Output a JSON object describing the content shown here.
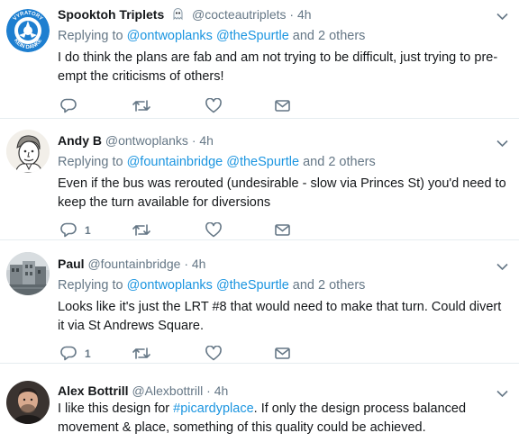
{
  "tweets": [
    {
      "name": "Spooktoh Triplets",
      "handle": "@cocteautriplets",
      "dot": "·",
      "time": "4h",
      "reply_prefix": "Replying to",
      "mention1": "@ontwoplanks",
      "mention2": "@theSpurtle",
      "reply_suffix": "and 2 others",
      "text": "I do think the plans are fab and am not trying to be difficult, just trying to pre-empt the criticisms of others!",
      "reply_count": ""
    },
    {
      "name": "Andy B",
      "handle": "@ontwoplanks",
      "dot": "·",
      "time": "4h",
      "reply_prefix": "Replying to",
      "mention1": "@fountainbridge",
      "mention2": "@theSpurtle",
      "reply_suffix": "and 2 others",
      "text": "Even if the bus was rerouted (undesirable - slow via Princes St) you'd need to keep the turn available for diversions",
      "reply_count": "1"
    },
    {
      "name": "Paul",
      "handle": "@fountainbridge",
      "dot": "·",
      "time": "4h",
      "reply_prefix": "Replying to",
      "mention1": "@ontwoplanks",
      "mention2": "@theSpurtle",
      "reply_suffix": "and 2 others",
      "text": "Looks like it's just the LRT #8 that would need to make that turn.  Could divert it via St Andrews Square.",
      "reply_count": "1"
    },
    {
      "name": "Alex Bottrill",
      "handle": "@Alexbottrill",
      "dot": "·",
      "time": "4h",
      "text_before": "I like this design for",
      "hashtag": "#picardyplace",
      "text_after": ". If only the design process balanced movement & place, something of this quality could be achieved."
    }
  ],
  "logo_text": {
    "top": "VYRATORY",
    "bottom": "KEIN DANKE"
  },
  "colors": {
    "link": "#1b95e0",
    "muted": "#657786",
    "text": "#14171a",
    "logo_blue": "#1e7fd0"
  }
}
